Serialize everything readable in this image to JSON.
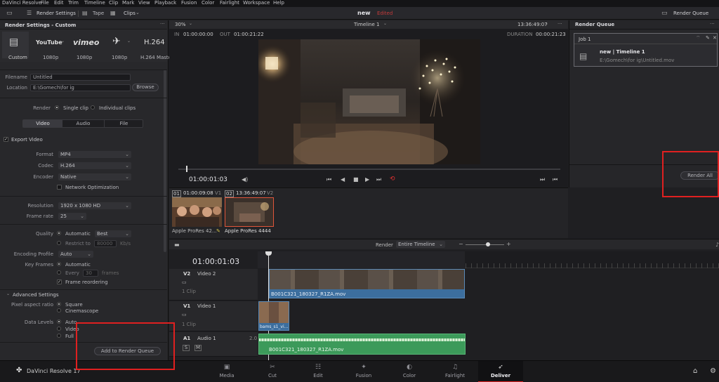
{
  "menu": [
    "DaVinci Resolve",
    "File",
    "Edit",
    "Trim",
    "Timeline",
    "Clip",
    "Mark",
    "View",
    "Playback",
    "Fusion",
    "Color",
    "Fairlight",
    "Workspace",
    "Help"
  ],
  "toolbar": {
    "render_settings": "Render Settings",
    "tape": "Tape",
    "clips": "Clips",
    "project_name": "new",
    "project_status": "Edited",
    "render_queue": "Render Queue"
  },
  "left": {
    "header": "Render Settings - Custom",
    "presets": [
      {
        "name": "Custom",
        "icon": "film-strip-icon"
      },
      {
        "name": "1080p",
        "icon": "youtube-logo"
      },
      {
        "name": "1080p",
        "icon": "vimeo-logo"
      },
      {
        "name": "1080p",
        "icon": "twitter-logo"
      },
      {
        "name": "H.264 Master",
        "icon": "h264-logo"
      }
    ],
    "preset_logo_text": {
      "youtube": "YouTube",
      "vimeo": "vimeo",
      "h264": "H.264"
    },
    "filename_label": "Filename",
    "filename_value": "Untitled",
    "location_label": "Location",
    "location_value": "E:\\Gomech\\for ig",
    "browse": "Browse",
    "render_label": "Render",
    "single_clip": "Single clip",
    "individual_clips": "Individual clips",
    "tabs": [
      "Video",
      "Audio",
      "File"
    ],
    "export_video": "Export Video",
    "format_label": "Format",
    "format_value": "MP4",
    "codec_label": "Codec",
    "codec_value": "H.264",
    "encoder_label": "Encoder",
    "encoder_value": "Native",
    "network_opt": "Network Optimization",
    "resolution_label": "Resolution",
    "resolution_value": "1920 x 1080 HD",
    "framerate_label": "Frame rate",
    "framerate_value": "25",
    "quality_label": "Quality",
    "automatic": "Automatic",
    "best": "Best",
    "restrict_to": "Restrict to",
    "restrict_value": "80000",
    "restrict_unit": "Kb/s",
    "encoding_profile_label": "Encoding Profile",
    "encoding_profile_value": "Auto",
    "keyframes_label": "Key Frames",
    "kf_automatic": "Automatic",
    "kf_every": "Every",
    "kf_every_value": "30",
    "kf_frames": "frames",
    "frame_reordering": "Frame reordering",
    "advanced_settings": "Advanced Settings",
    "pixel_aspect_label": "Pixel aspect ratio",
    "square": "Square",
    "cinemascope": "Cinemascope",
    "data_levels_label": "Data Levels",
    "dl_auto": "Auto",
    "dl_video": "Video",
    "dl_full": "Full",
    "add_to_queue": "Add to Render Queue"
  },
  "viewer": {
    "zoom": "30%",
    "in_label": "IN",
    "in_tc": "01:00:00:00",
    "out_label": "OUT",
    "out_tc": "01:00:21:22",
    "timeline_name": "Timeline 1",
    "tc_right": "13:36:49:07",
    "duration_label": "DURATION",
    "duration_tc": "00:00:21:23",
    "current_tc": "01:00:01:03",
    "playhead_fraction": 0.02
  },
  "clips": [
    {
      "num": "01",
      "tc": "01:00:09:08",
      "track": "V1",
      "name": "Apple ProRes 42..."
    },
    {
      "num": "02",
      "tc": "13:36:49:07",
      "track": "V2",
      "name": "Apple ProRes 4444"
    }
  ],
  "queue": {
    "header": "Render Queue",
    "job_label": "Job 1",
    "job_title": "new | Timeline 1",
    "job_path": "E:\\Gomech\\for ig\\Untitled.mov",
    "render_all": "Render All"
  },
  "timeline": {
    "render_label": "Render",
    "render_range": "Entire Timeline",
    "tc": "01:00:01:03",
    "v2_id": "V2",
    "v2_name": "Video 2",
    "v2_count": "1 Clip",
    "v2_clip": "B001C321_180327_R1ZA.mov",
    "v1_id": "V1",
    "v1_name": "Video 1",
    "v1_count": "1 Clip",
    "v1_clip": "bams_s1_vi...",
    "a1_id": "A1",
    "a1_name": "Audio 1",
    "a1_level": "2.0",
    "a1_clip": "B001C321_180327_R1ZA.mov",
    "solo": "S",
    "mute": "M"
  },
  "bottom": {
    "app_name": "DaVinci Resolve 17",
    "pages": [
      "Media",
      "Cut",
      "Edit",
      "Fusion",
      "Color",
      "Fairlight",
      "Deliver"
    ],
    "active_page": "Deliver"
  },
  "colors": {
    "accent_red": "#e02020",
    "video_clip": "#3c6e9e",
    "audio_clip": "#3c9a5a",
    "selected_clip_border": "#e0553a"
  }
}
